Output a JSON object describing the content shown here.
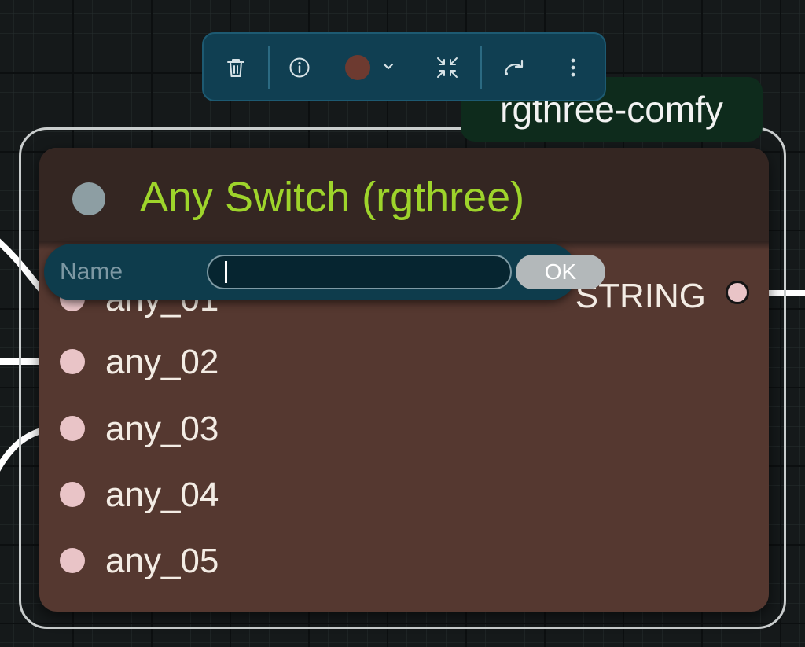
{
  "canvas": {
    "background": "#15191a",
    "link_color": "#ffffff"
  },
  "toolbar": {
    "background": "#103f52",
    "buttons": [
      {
        "icon": "trash-icon",
        "label": ""
      },
      {
        "icon": "info-icon",
        "label": ""
      },
      {
        "icon": "color-swatch-icon",
        "label": "",
        "color": "#6d3a30"
      },
      {
        "icon": "collapse-icon",
        "label": ""
      },
      {
        "icon": "bypass-icon",
        "label": ""
      },
      {
        "icon": "more-vertical-icon",
        "label": ""
      }
    ]
  },
  "badge": {
    "text": "rgthree-comfy",
    "background": "#0e2b1c"
  },
  "node": {
    "title": "Any Switch (rgthree)",
    "title_color": "#9ed42b",
    "header_color": "#342622",
    "body_color": "#553830",
    "inputs": [
      "any_01",
      "any_02",
      "any_03",
      "any_04",
      "any_05"
    ],
    "output": "STRING",
    "slot_color": "#e9c4c7"
  },
  "prompt": {
    "label": "Name",
    "value": "",
    "ok_label": "OK"
  }
}
